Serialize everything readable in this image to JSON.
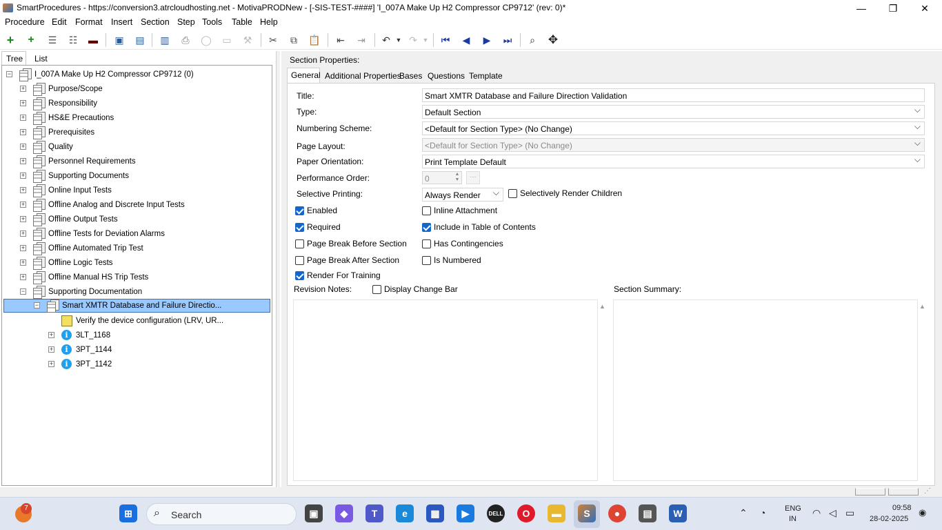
{
  "window": {
    "title": "SmartProcedures - https://conversion3.atrcloudhosting.net - MotivaPRODNew - [-SIS-TEST-####] 'I_007A Make Up H2 Compressor CP9712' (rev: 0)*",
    "minimize": "—",
    "restore": "❐",
    "close": "✕"
  },
  "menu": [
    "Procedure",
    "Edit",
    "Format",
    "Insert",
    "Section",
    "Step",
    "Tools",
    "Table",
    "Help"
  ],
  "left_tabs": {
    "tree": "Tree",
    "list": "List"
  },
  "tree": {
    "root": "I_007A Make Up H2 Compressor CP9712 (0)",
    "sections": [
      "Purpose/Scope",
      "Responsibility",
      "HS&E Precautions",
      "Prerequisites",
      "Quality",
      "Personnel Requirements",
      "Supporting Documents",
      "Online Input Tests",
      "Offline Analog and Discrete Input Tests",
      "Offline Output Tests",
      "Offline Tests for Deviation Alarms",
      "Offline Automated Trip Test",
      "Offline Logic Tests",
      "Offline Manual HS Trip Tests",
      "Supporting Documentation"
    ],
    "selected": "Smart XMTR Database and Failure Directio...",
    "step": "Verify the device configuration (LRV, UR...",
    "children": [
      "3LT_1168",
      "3PT_1144",
      "3PT_1142"
    ]
  },
  "props": {
    "header": "Section Properties:",
    "tabs": [
      "General",
      "Additional Properties",
      "Bases",
      "Questions",
      "Template"
    ],
    "labels": {
      "title": "Title:",
      "type": "Type:",
      "numbering": "Numbering Scheme:",
      "page_layout": "Page Layout:",
      "orientation": "Paper Orientation:",
      "performance": "Performance Order:",
      "selective": "Selective Printing:"
    },
    "values": {
      "title": "Smart XMTR Database and Failure Direction Validation",
      "type": "Default Section",
      "numbering": "<Default for Section Type> (No Change)",
      "page_layout": "<Default for Section Type> (No Change)",
      "orientation": "Print Template Default",
      "performance": "0",
      "selective": "Always Render"
    },
    "checks": {
      "selectively_render_children": "Selectively Render Children",
      "enabled": "Enabled",
      "inline_attachment": "Inline Attachment",
      "required": "Required",
      "include_toc": "Include in Table of Contents",
      "page_break_before": "Page Break Before Section",
      "has_contingencies": "Has Contingencies",
      "page_break_after": "Page Break After Section",
      "is_numbered": "Is Numbered",
      "render_training": "Render For Training",
      "display_change_bar": "Display Change Bar"
    },
    "revision_notes": "Revision Notes:",
    "section_summary": "Section Summary:"
  },
  "taskbar": {
    "search": "Search",
    "lang1": "ENG",
    "lang2": "IN",
    "time": "09:58",
    "date": "28-02-2025",
    "badge": "7"
  }
}
